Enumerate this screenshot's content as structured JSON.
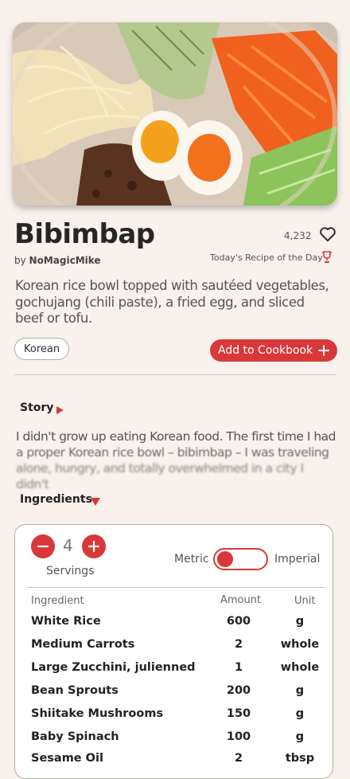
{
  "recipe": {
    "title": "Bibimbap",
    "author_prefix": "by",
    "author": "NoMagicMike",
    "likes": "4,232",
    "badge": "Today's Recipe of the Day",
    "description": "Korean rice bowl topped with sautéed vegetables, gochujang (chili paste), a fried egg, and sliced beef or tofu.",
    "tag": "Korean",
    "add_button": "Add to Cookbook",
    "hero_image": "bibimbap-bowl-photo"
  },
  "story": {
    "title": "Story",
    "lines": [
      "I didn't grow up eating Korean food. The first time I had",
      "a proper Korean rice bowl – bibimbap – I was traveling",
      "alone, hungry, and totally overwhelmed in a city I didn't"
    ]
  },
  "ingredients": {
    "title": "Ingredients",
    "servings": "4",
    "servings_label": "Servings",
    "unit_left": "Metric",
    "unit_right": "Imperial",
    "headers": {
      "ingredient": "Ingredient",
      "amount": "Amount",
      "unit": "Unit"
    },
    "rows": [
      {
        "name": "White Rice",
        "amount": "600",
        "unit": "g"
      },
      {
        "name": "Medium Carrots",
        "amount": "2",
        "unit": "whole"
      },
      {
        "name": "Large Zucchini, julienned",
        "amount": "1",
        "unit": "whole"
      },
      {
        "name": "Bean Sprouts",
        "amount": "200",
        "unit": "g"
      },
      {
        "name": "Shiitake Mushrooms",
        "amount": "150",
        "unit": "g"
      },
      {
        "name": "Baby Spinach",
        "amount": "100",
        "unit": "g"
      },
      {
        "name": "Sesame Oil",
        "amount": "2",
        "unit": "tbsp"
      }
    ]
  },
  "colors": {
    "accent": "#d9383a",
    "background": "#f8f1ec",
    "border": "#aab2a0"
  },
  "icons": {
    "like": "heart-outline-icon",
    "badge": "trophy-icon",
    "add": "plus-icon",
    "collapsed": "triangle-right-icon",
    "expanded": "triangle-down-icon"
  }
}
